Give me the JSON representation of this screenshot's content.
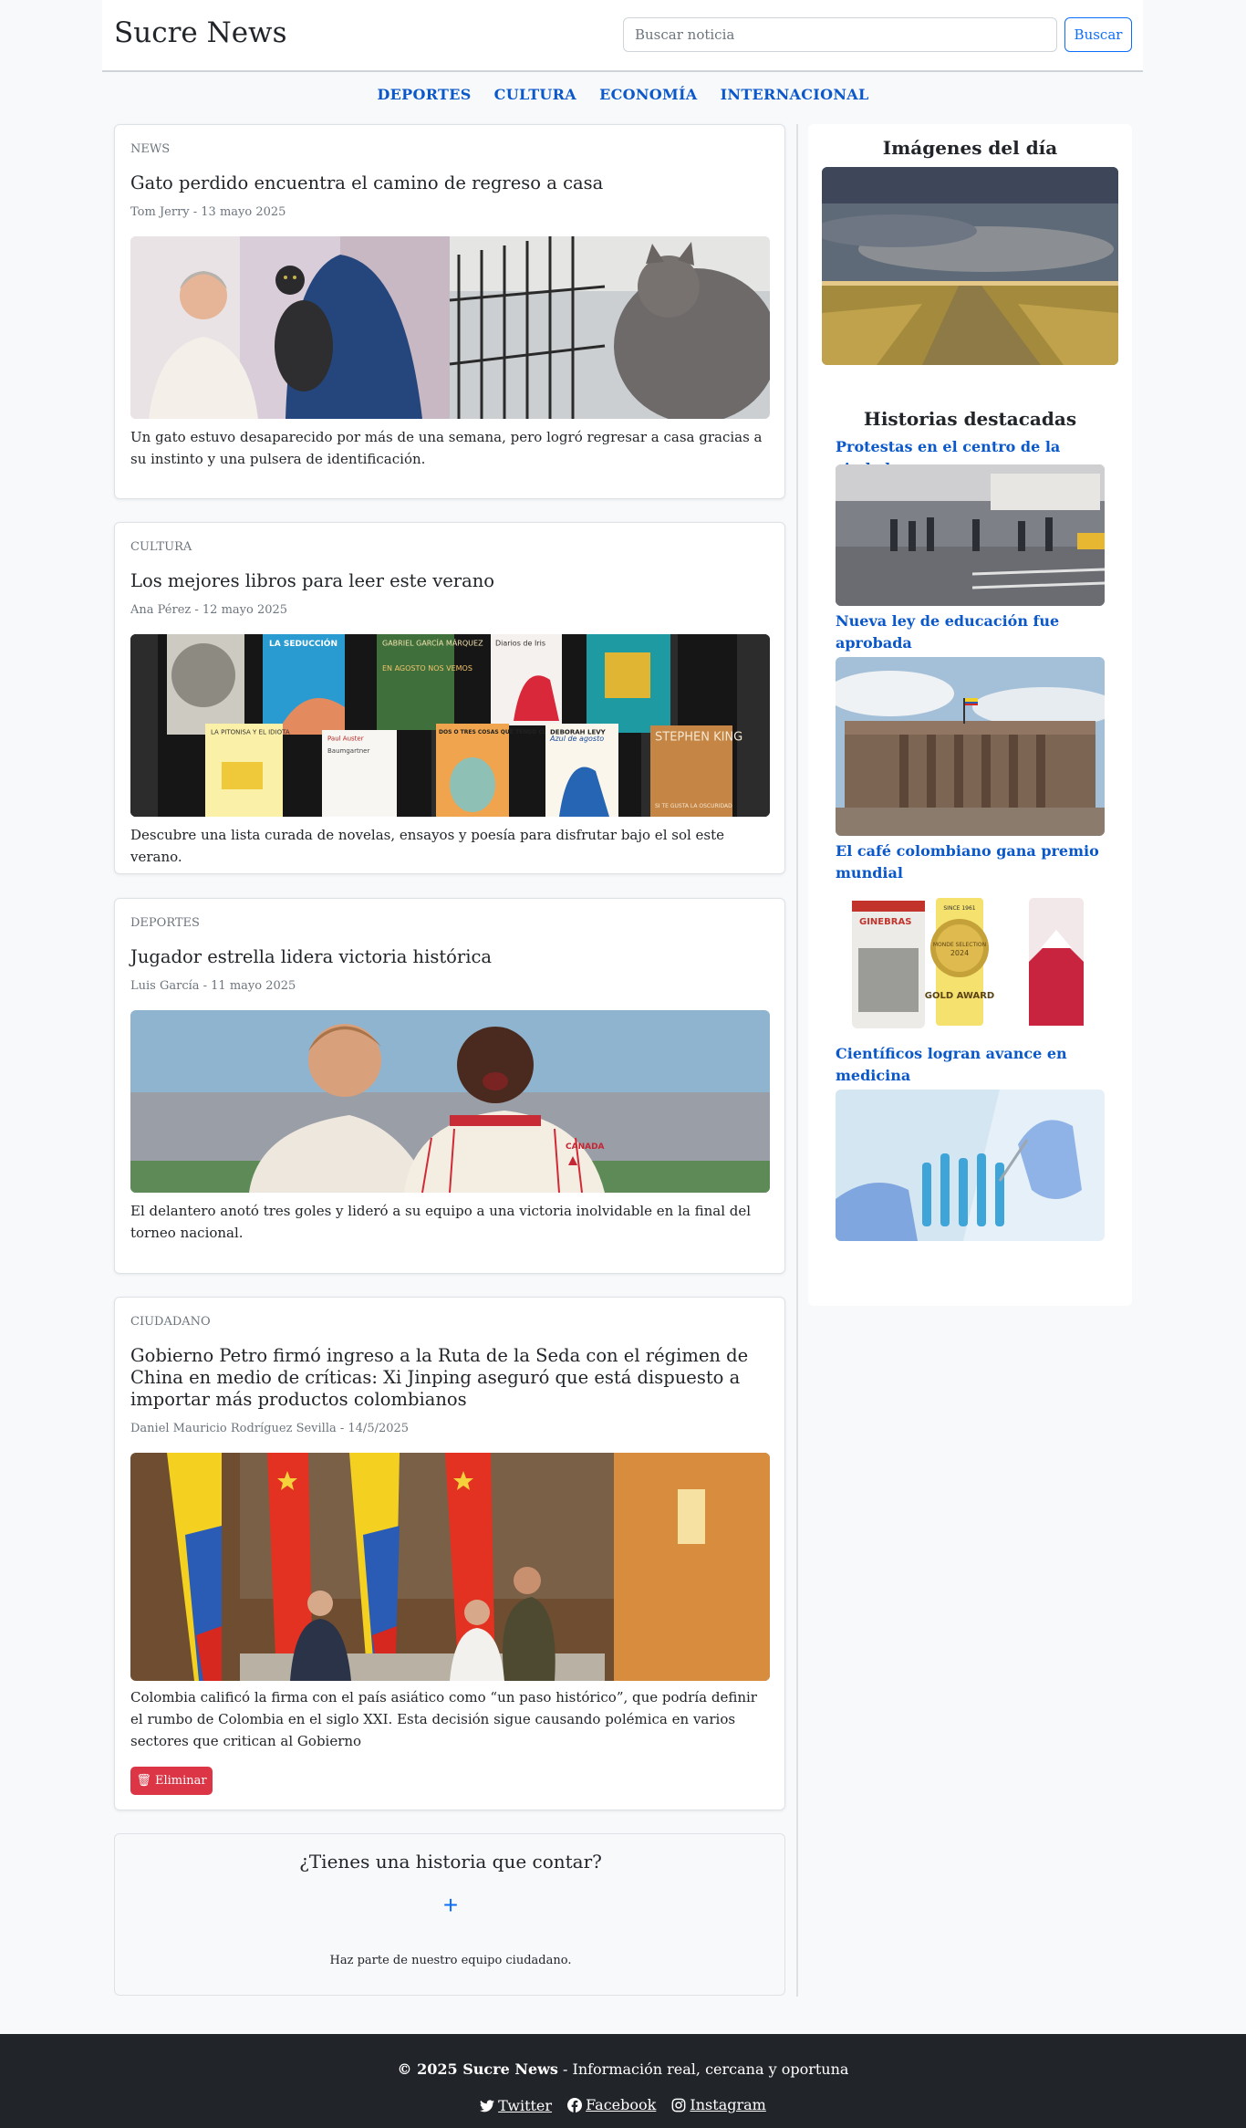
{
  "header": {
    "brand": "Sucre News",
    "search_placeholder": "Buscar noticia",
    "search_button": "Buscar"
  },
  "nav": [
    "DEPORTES",
    "CULTURA",
    "ECONOMÍA",
    "INTERNACIONAL"
  ],
  "articles": [
    {
      "category": "NEWS",
      "title": "Gato perdido encuentra el camino de regreso a casa",
      "meta": "Tom Jerry - 13 mayo 2025",
      "description": "Un gato estuvo desaparecido por más de una semana, pero logró regresar a casa gracias a su instinto y una pulsera de identificación."
    },
    {
      "category": "CULTURA",
      "title": "Los mejores libros para leer este verano",
      "meta": "Ana Pérez - 12 mayo 2025",
      "description": "Descubre una lista curada de novelas, ensayos y poesía para disfrutar bajo el sol este verano.",
      "book_covers": [
        "LA SEDUCCIÓN",
        "GABRIEL GARCÍA MÁRQUEZ",
        "EN AGOSTO NOS VEMOS",
        "Diarios de Iris",
        "LA PITONISA Y EL IDIOTA",
        "Paul Auster",
        "Baumgartner",
        "DOS O TRES COSAS QUE TENGO CLARAS",
        "Azul de agosto",
        "DEBORAH LEVY",
        "STEPHEN KING",
        "SI TE GUSTA LA OSCURIDAD"
      ]
    },
    {
      "category": "DEPORTES",
      "title": "Jugador estrella lidera victoria histórica",
      "meta": "Luis García - 11 mayo 2025",
      "description": "El delantero anotó tres goles y lideró a su equipo a una victoria inolvidable en la final del torneo nacional.",
      "jersey_text": "CANADA"
    },
    {
      "category": "CIUDADANO",
      "title": "Gobierno Petro firmó ingreso a la Ruta de la Seda con el régimen de China en medio de críticas: Xi Jinping aseguró que está dispuesto a importar más productos colombianos",
      "meta": "Daniel Mauricio Rodríguez Sevilla - 14/5/2025",
      "description": "Colombia calificó la firma con el país asiático como “un paso histórico”, que podría definir el rumbo de Colombia en el siglo XXI. Esta decisión sigue causando polémica en varios sectores que critican al Gobierno",
      "delete_button": "Eliminar"
    }
  ],
  "cta": {
    "title": "¿Tienes una historia que contar?",
    "plus": "+",
    "subtitle": "Haz parte de nuestro equipo ciudadano."
  },
  "sidebar": {
    "images_heading": "Imágenes del día",
    "featured_heading": "Historias destacadas",
    "stories": [
      "Protestas en el centro de la ciudad",
      "Nueva ley de educación fue aprobada",
      "El café colombiano gana premio mundial",
      "Científicos logran avance en medicina"
    ],
    "coffee_labels": [
      "GINEBRAS",
      "MONDE SELECTION",
      "SINCE 1961",
      "2024",
      "GOLD AWARD"
    ]
  },
  "footer": {
    "copyright": "© 2025 Sucre News",
    "tagline": " - Información real, cercana y oportuna",
    "twitter": "Twitter",
    "facebook": "Facebook",
    "instagram": "Instagram"
  },
  "colors": {
    "link": "#0a58ca",
    "primary": "#0d6efd",
    "danger": "#dc3545",
    "footer_bg": "#212529",
    "page_bg": "#f8f9fa"
  }
}
